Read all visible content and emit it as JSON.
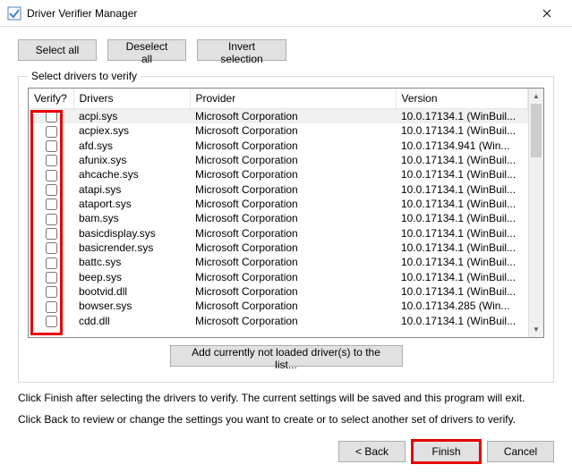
{
  "window": {
    "title": "Driver Verifier Manager"
  },
  "buttons": {
    "select_all": "Select all",
    "deselect_all": "Deselect all",
    "invert": "Invert selection",
    "add_not_loaded": "Add currently not loaded driver(s) to the list...",
    "back": "< Back",
    "finish": "Finish",
    "cancel": "Cancel"
  },
  "group": {
    "legend": "Select drivers to verify"
  },
  "columns": {
    "verify": "Verify?",
    "drivers": "Drivers",
    "provider": "Provider",
    "version": "Version"
  },
  "rows": [
    {
      "driver": "acpi.sys",
      "provider": "Microsoft Corporation",
      "version": "10.0.17134.1 (WinBuil...",
      "sel": true
    },
    {
      "driver": "acpiex.sys",
      "provider": "Microsoft Corporation",
      "version": "10.0.17134.1 (WinBuil..."
    },
    {
      "driver": "afd.sys",
      "provider": "Microsoft Corporation",
      "version": "10.0.17134.941 (Win..."
    },
    {
      "driver": "afunix.sys",
      "provider": "Microsoft Corporation",
      "version": "10.0.17134.1 (WinBuil..."
    },
    {
      "driver": "ahcache.sys",
      "provider": "Microsoft Corporation",
      "version": "10.0.17134.1 (WinBuil..."
    },
    {
      "driver": "atapi.sys",
      "provider": "Microsoft Corporation",
      "version": "10.0.17134.1 (WinBuil..."
    },
    {
      "driver": "ataport.sys",
      "provider": "Microsoft Corporation",
      "version": "10.0.17134.1 (WinBuil..."
    },
    {
      "driver": "bam.sys",
      "provider": "Microsoft Corporation",
      "version": "10.0.17134.1 (WinBuil..."
    },
    {
      "driver": "basicdisplay.sys",
      "provider": "Microsoft Corporation",
      "version": "10.0.17134.1 (WinBuil..."
    },
    {
      "driver": "basicrender.sys",
      "provider": "Microsoft Corporation",
      "version": "10.0.17134.1 (WinBuil..."
    },
    {
      "driver": "battc.sys",
      "provider": "Microsoft Corporation",
      "version": "10.0.17134.1 (WinBuil..."
    },
    {
      "driver": "beep.sys",
      "provider": "Microsoft Corporation",
      "version": "10.0.17134.1 (WinBuil..."
    },
    {
      "driver": "bootvid.dll",
      "provider": "Microsoft Corporation",
      "version": "10.0.17134.1 (WinBuil..."
    },
    {
      "driver": "bowser.sys",
      "provider": "Microsoft Corporation",
      "version": "10.0.17134.285 (Win..."
    },
    {
      "driver": "cdd.dll",
      "provider": "Microsoft Corporation",
      "version": "10.0.17134.1 (WinBuil..."
    }
  ],
  "info": {
    "line1": "Click Finish after selecting the drivers to verify. The current settings will be saved and this program will exit.",
    "line2": "Click Back to review or change the settings you want to create or to select another set of drivers to verify."
  }
}
